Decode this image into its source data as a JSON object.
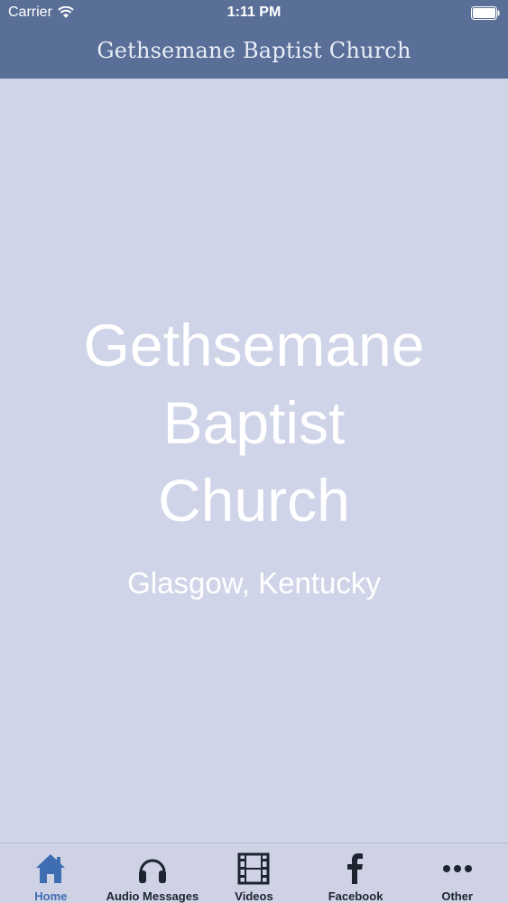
{
  "status_bar": {
    "carrier": "Carrier",
    "time": "1:11 PM",
    "wifi_icon": "wifi-icon",
    "battery_icon": "battery-icon"
  },
  "header": {
    "title": "Gethsemane Baptist Church",
    "background_color": "#5a6f98"
  },
  "main": {
    "name_lines": [
      "Gethsemane",
      "Baptist",
      "Church"
    ],
    "location": "Glasgow, Kentucky",
    "background_color": "#d0d4e8"
  },
  "tabbar": {
    "active_color": "#3f6db2",
    "items": [
      {
        "label": "Home",
        "icon": "home-icon",
        "active": true
      },
      {
        "label": "Audio Messages",
        "icon": "headphones-icon",
        "active": false
      },
      {
        "label": "Videos",
        "icon": "film-icon",
        "active": false
      },
      {
        "label": "Facebook",
        "icon": "facebook-icon",
        "active": false
      },
      {
        "label": "Other",
        "icon": "more-icon",
        "active": false
      }
    ]
  }
}
